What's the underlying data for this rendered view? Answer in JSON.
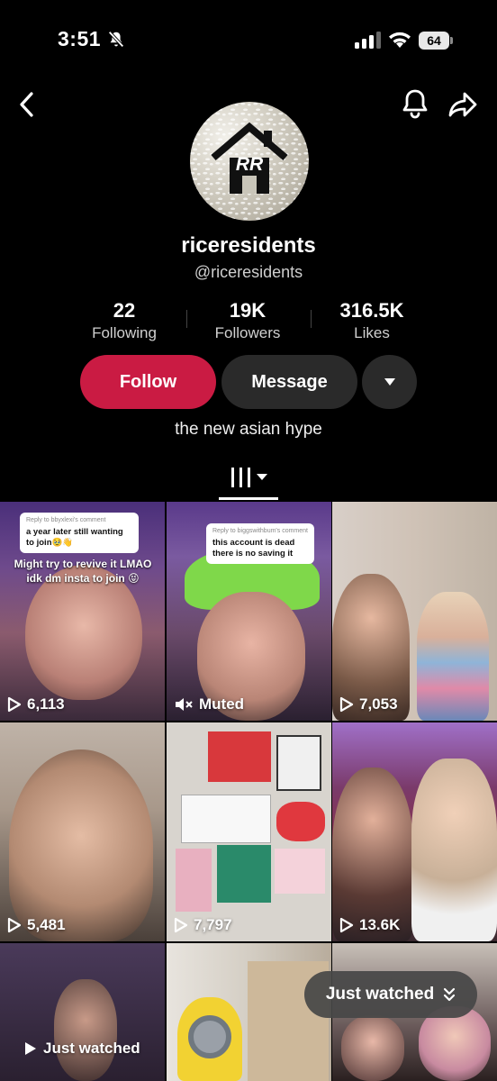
{
  "status_bar": {
    "time": "3:51",
    "battery": "64"
  },
  "profile": {
    "username": "riceresidents",
    "handle": "@riceresidents",
    "avatar_initials": "RR",
    "bio": "the new asian hype"
  },
  "stats": [
    {
      "value": "22",
      "label": "Following"
    },
    {
      "value": "19K",
      "label": "Followers"
    },
    {
      "value": "316.5K",
      "label": "Likes"
    }
  ],
  "actions": {
    "follow": "Follow",
    "message": "Message"
  },
  "videos": [
    {
      "count": "6,113",
      "comment_reply": "Reply to bbyxlexi's comment",
      "comment": "a year later still wanting to join🥹👋",
      "caption": "Might try to revive it LMAO idk dm insta to join 😝"
    },
    {
      "count": "Muted",
      "comment_reply": "Reply to biggswithbum's comment",
      "comment": "this account is dead there is no saving it"
    },
    {
      "count": "7,053"
    },
    {
      "count": "5,481"
    },
    {
      "count": "7,797"
    },
    {
      "count": "13.6K"
    },
    {
      "count": "Just watched"
    },
    {
      "count": ""
    },
    {
      "count": ""
    }
  ],
  "just_watched_pill": "Just watched",
  "colors": {
    "follow": "#ca1b43",
    "background": "#000000",
    "secondary_button": "#2a2a2a"
  }
}
